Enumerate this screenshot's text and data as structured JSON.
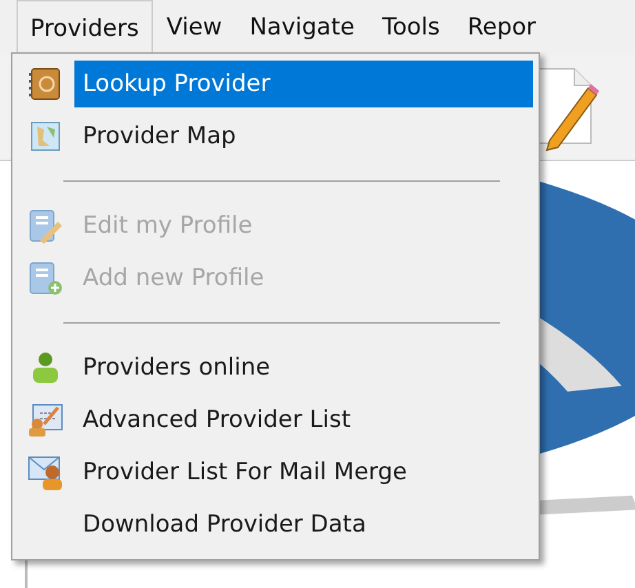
{
  "menu_bar": [
    {
      "label": "Providers",
      "selected": true
    },
    {
      "label": "View",
      "selected": false
    },
    {
      "label": "Navigate",
      "selected": false
    },
    {
      "label": "Tools",
      "selected": false
    },
    {
      "label": "Repor",
      "selected": false
    }
  ],
  "dropdown": [
    {
      "kind": "item",
      "label": "Lookup Provider",
      "selected": true,
      "disabled": false
    },
    {
      "kind": "item",
      "label": "Provider Map",
      "selected": false,
      "disabled": false
    },
    {
      "kind": "separator"
    },
    {
      "kind": "item",
      "label": "Edit my Profile",
      "selected": false,
      "disabled": true
    },
    {
      "kind": "item",
      "label": "Add new Profile",
      "selected": false,
      "disabled": true
    },
    {
      "kind": "separator"
    },
    {
      "kind": "item",
      "label": "Providers online",
      "selected": false,
      "disabled": false
    },
    {
      "kind": "item",
      "label": "Advanced Provider List",
      "selected": false,
      "disabled": false
    },
    {
      "kind": "item",
      "label": "Provider List For Mail Merge",
      "selected": false,
      "disabled": false
    },
    {
      "kind": "item",
      "label": "Download Provider Data",
      "selected": false,
      "disabled": false
    }
  ]
}
